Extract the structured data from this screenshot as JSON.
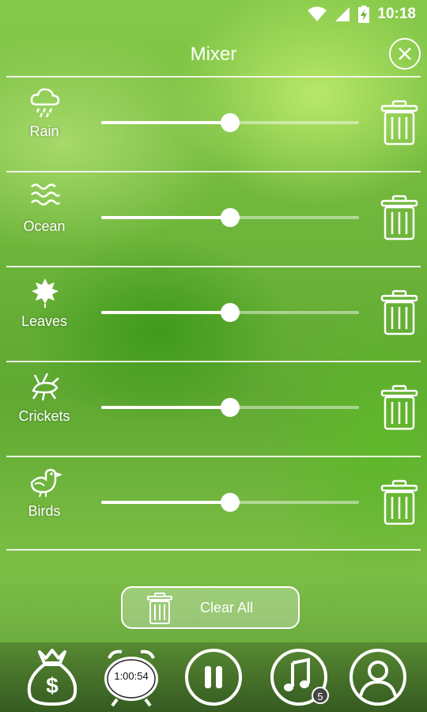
{
  "status_bar": {
    "time": "10:18"
  },
  "header": {
    "title": "Mixer"
  },
  "sounds": [
    {
      "label": "Rain",
      "icon": "rain-cloud-icon",
      "volume": 0.5
    },
    {
      "label": "Ocean",
      "icon": "waves-icon",
      "volume": 0.5
    },
    {
      "label": "Leaves",
      "icon": "leaf-icon",
      "volume": 0.5
    },
    {
      "label": "Crickets",
      "icon": "cricket-icon",
      "volume": 0.5
    },
    {
      "label": "Birds",
      "icon": "bird-icon",
      "volume": 0.5
    }
  ],
  "clear_all": {
    "label": "Clear All"
  },
  "bottom_bar": {
    "timer_text": "1:00:54",
    "playlist_count": "5",
    "icons": [
      "money-bag-icon",
      "alarm-clock-icon",
      "pause-icon",
      "music-note-icon",
      "user-icon"
    ]
  }
}
